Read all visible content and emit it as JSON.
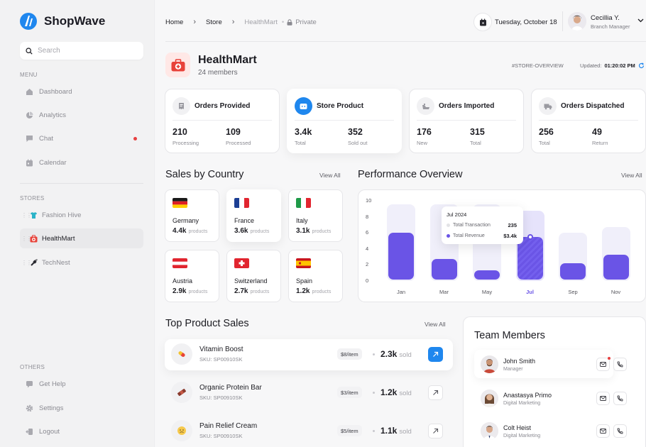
{
  "app": {
    "name": "ShopWave"
  },
  "search": {
    "placeholder": "Search"
  },
  "sidebar": {
    "menu_label": "MENU",
    "menu": [
      {
        "label": "Dashboard",
        "icon": "dashboard-icon"
      },
      {
        "label": "Analytics",
        "icon": "analytics-icon"
      },
      {
        "label": "Chat",
        "icon": "chat-icon",
        "has_dot": true
      },
      {
        "label": "Calendar",
        "icon": "calendar-icon"
      }
    ],
    "stores_label": "STORES",
    "stores": [
      {
        "label": "Fashion Hive",
        "icon": "tshirt-icon"
      },
      {
        "label": "HealthMart",
        "icon": "medkit-icon",
        "active": true
      },
      {
        "label": "TechNest",
        "icon": "plug-icon"
      }
    ],
    "others_label": "OTHERS",
    "others": [
      {
        "label": "Get Help",
        "icon": "help-icon"
      },
      {
        "label": "Settings",
        "icon": "gear-icon"
      },
      {
        "label": "Logout",
        "icon": "logout-icon"
      }
    ]
  },
  "breadcrumb": {
    "home": "Home",
    "store": "Store",
    "current": "HealthMart",
    "privacy": "Private"
  },
  "header": {
    "date": "Tuesday, October 18",
    "user_name": "Cecillia Y.",
    "user_role": "Branch Manager"
  },
  "store": {
    "name": "HealthMart",
    "members": "24 members",
    "tag": "#STORE-OVERVIEW",
    "updated_label": "Updated:",
    "updated_time": "01:20:02 PM"
  },
  "stats": [
    {
      "title": "Orders Provided",
      "icon": "receipt-icon",
      "v1": "210",
      "l1": "Processing",
      "v2": "109",
      "l2": "Processed"
    },
    {
      "title": "Store Product",
      "icon": "store-icon",
      "v1": "3.4k",
      "l1": "Total",
      "v2": "352",
      "l2": "Sold out"
    },
    {
      "title": "Orders Imported",
      "icon": "ship-icon",
      "v1": "176",
      "l1": "New",
      "v2": "315",
      "l2": "Total"
    },
    {
      "title": "Orders Dispatched",
      "icon": "truck-icon",
      "v1": "256",
      "l1": "Total",
      "v2": "49",
      "l2": "Return"
    }
  ],
  "sales_by_country": {
    "title": "Sales by Country",
    "view_all": "View All",
    "unit": "products",
    "items": [
      {
        "name": "Germany",
        "value": "4.4k",
        "flag": "germany-flag"
      },
      {
        "name": "France",
        "value": "3.6k",
        "flag": "france-flag"
      },
      {
        "name": "Italy",
        "value": "3.1k",
        "flag": "italy-flag"
      },
      {
        "name": "Austria",
        "value": "2.9k",
        "flag": "austria-flag"
      },
      {
        "name": "Switzerland",
        "value": "2.7k",
        "flag": "switzerland-flag"
      },
      {
        "name": "Spain",
        "value": "1.2k",
        "flag": "spain-flag"
      }
    ]
  },
  "performance": {
    "title": "Performance Overview",
    "view_all": "View All"
  },
  "chart_data": {
    "type": "bar",
    "categories": [
      "Jan",
      "Mar",
      "May",
      "Jul",
      "Sep",
      "Nov"
    ],
    "values": [
      6,
      2.7,
      1.3,
      5.5,
      2.2,
      3.3
    ],
    "background_values": [
      10,
      10,
      10,
      9.2,
      6.5,
      7.2
    ],
    "highlighted": "Jul",
    "yticks": [
      10,
      8,
      6,
      4,
      2,
      0
    ],
    "ylim": [
      0,
      10
    ],
    "tooltip": {
      "title": "Jul 2024",
      "rows": [
        {
          "label": "Total Transaction",
          "value": "235",
          "color": "#e3e3e6"
        },
        {
          "label": "Total Revenue",
          "value": "$3.4k",
          "color": "#6a54e6"
        }
      ]
    },
    "bar_color": "#6a54e6"
  },
  "top_products": {
    "title": "Top Product Sales",
    "view_all": "View All",
    "sold_unit": "sold",
    "items": [
      {
        "name": "Vitamin Boost",
        "sku": "SKU: SP00910SK",
        "price": "$8/item",
        "sold": "2.3k",
        "thumb": "pill-icon"
      },
      {
        "name": "Organic Protein Bar",
        "sku": "SKU: SP00910SK",
        "price": "$3/item",
        "sold": "1.2k",
        "thumb": "protein-bar-icon"
      },
      {
        "name": "Pain Relief Cream",
        "sku": "SKU: SP00910SK",
        "price": "$5/item",
        "sold": "1.1k",
        "thumb": "cream-icon"
      }
    ]
  },
  "team": {
    "title": "Team Members",
    "members": [
      {
        "name": "John Smith",
        "role": "Manager"
      },
      {
        "name": "Anastasya Primo",
        "role": "Digital Marketing"
      },
      {
        "name": "Colt Heist",
        "role": "Digital Marketing"
      }
    ]
  },
  "colors": {
    "accent_blue": "#1f87ee",
    "accent_purple": "#6a54e6",
    "alert_red": "#e84040"
  }
}
